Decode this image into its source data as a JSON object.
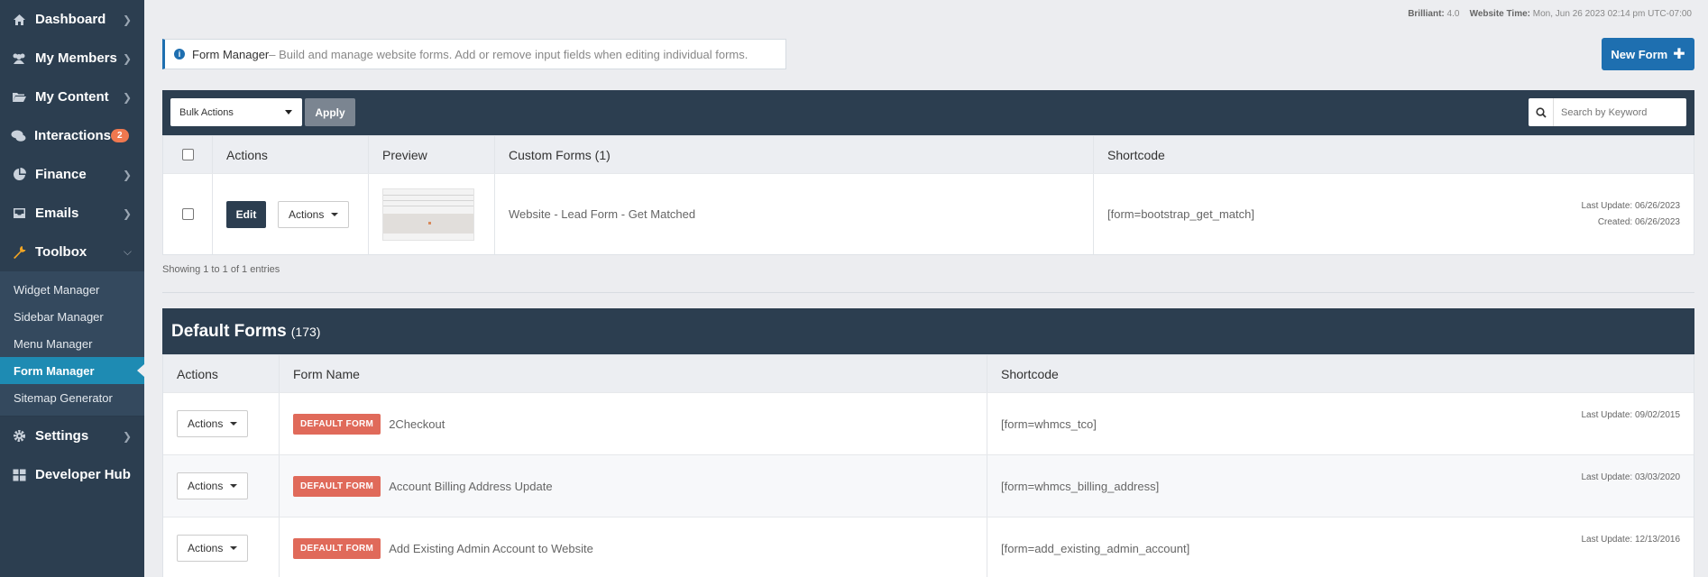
{
  "sidebar": {
    "items": [
      {
        "label": "Dashboard",
        "icon": "home-icon"
      },
      {
        "label": "My Members",
        "icon": "users-icon"
      },
      {
        "label": "My Content",
        "icon": "folder-icon"
      },
      {
        "label": "Interactions",
        "icon": "comments-icon",
        "badge": "2"
      },
      {
        "label": "Finance",
        "icon": "pie-chart-icon"
      },
      {
        "label": "Emails",
        "icon": "inbox-icon"
      },
      {
        "label": "Toolbox",
        "icon": "wrench-icon"
      }
    ],
    "toolbox_sub": [
      "Widget Manager",
      "Sidebar Manager",
      "Menu Manager",
      "Form Manager",
      "Sitemap Generator"
    ],
    "active_sub": "Form Manager",
    "bottom": [
      {
        "label": "Settings",
        "icon": "gear-icon"
      },
      {
        "label": "Developer Hub",
        "icon": "grid-icon"
      }
    ]
  },
  "topmeta": {
    "brilliant_label": "Brilliant:",
    "brilliant_value": "4.0",
    "time_label": "Website Time:",
    "time_value": "Mon, Jun 26 2023 02:14 pm UTC-07:00"
  },
  "info": {
    "title": "Form Manager",
    "text": " – Build and manage website forms. Add or remove input fields when editing individual forms."
  },
  "new_form_label": "New Form",
  "custom": {
    "bulk_label": "Bulk Actions",
    "apply_label": "Apply",
    "search_placeholder": "Search by Keyword",
    "headers": [
      "Actions",
      "Preview",
      "Custom Forms (1)",
      "Shortcode"
    ],
    "rows": [
      {
        "edit": "Edit",
        "actions": "Actions",
        "name": "Website - Lead Form - Get Matched",
        "shortcode": "[form=bootstrap_get_match]",
        "last_update": "Last Update: 06/26/2023",
        "created": "Created: 06/26/2023"
      }
    ],
    "showing": "Showing 1 to 1 of 1 entries"
  },
  "default": {
    "title": "Default Forms",
    "count": "(173)",
    "headers": [
      "Actions",
      "Form Name",
      "Shortcode"
    ],
    "tag": "DEFAULT FORM",
    "rows": [
      {
        "actions": "Actions",
        "name": "2Checkout",
        "shortcode": "[form=whmcs_tco]",
        "last_update": "Last Update: 09/02/2015"
      },
      {
        "actions": "Actions",
        "name": "Account Billing Address Update",
        "shortcode": "[form=whmcs_billing_address]",
        "last_update": "Last Update: 03/03/2020"
      },
      {
        "actions": "Actions",
        "name": "Add Existing Admin Account to Website",
        "shortcode": "[form=add_existing_admin_account]",
        "last_update": "Last Update: 12/13/2016"
      }
    ]
  },
  "colors": {
    "sidebar": "#2c3e50",
    "accent": "#1e6fb0",
    "active": "#1e8bb3",
    "tag": "#e06a5a",
    "badge": "#f0784f"
  }
}
